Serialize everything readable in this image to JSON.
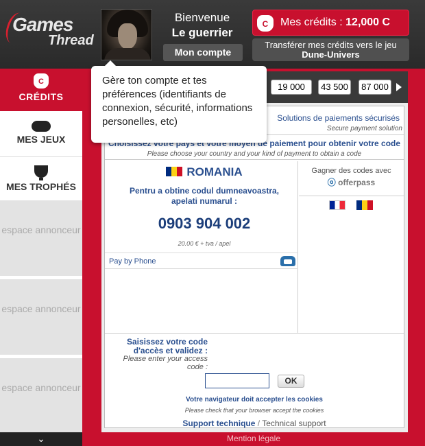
{
  "header": {
    "logo_line1": "Games",
    "logo_line2": "Thread",
    "welcome": "Bienvenue",
    "username": "Le guerrier",
    "account_button": "Mon compte",
    "credits_label": "Mes crédits : ",
    "credits_amount": "12,000 C",
    "credits_icon": "C",
    "transfer_line1": "Transférer mes crédits vers le jeu",
    "transfer_game": "Dune-Univers"
  },
  "sidebar": {
    "credits_icon": "C",
    "credits": "CRÉDITS",
    "games": "MES JEUX",
    "trophies": "MES TROPHÉS",
    "ad_label": "espace annonceur",
    "scroll_icon": "⌄"
  },
  "amounts": [
    "19 000",
    "43 500",
    "87 000"
  ],
  "secure": {
    "title": "Solutions de paiements sécurisés",
    "subtitle": "Secure payment solution"
  },
  "choose": {
    "title": "Choisissez votre pays et votre moyen de paiement pour obtenir votre code",
    "subtitle": "Please choose your country and your kind of payment to obtain a code"
  },
  "payment": {
    "country": "ROMANIA",
    "instruction": "Pentru a obtine codul dumneavoastra, apelati numarul :",
    "phone_number": "0903 904 002",
    "price": "20.00 € + tva / apel",
    "method": "Pay by Phone"
  },
  "offerpass": {
    "label": "Gagner des codes avec",
    "brand_mark": "ⓞ",
    "brand_text": "offerpass"
  },
  "code_entry": {
    "label_fr": "Saisissez votre code d'accès et validez :",
    "label_en": "Please enter your access code :",
    "ok_button": "OK",
    "input_value": ""
  },
  "cookies": {
    "line_fr": "Votre navigateur doit accepter les cookies",
    "line_en": "Please check that your browser accept the cookies"
  },
  "support": {
    "fr": "Support technique",
    "sep": " / ",
    "en": "Technical support"
  },
  "footer": {
    "legal": "Mention légale"
  },
  "tooltip": {
    "text": "Gère ton compte et tes préférences (identifiants de connexion, sécurité, informations personelles, etc)"
  },
  "colors": {
    "brand_red": "#c8102e",
    "header_dark": "#333333",
    "link_blue": "#2a4f8f"
  }
}
